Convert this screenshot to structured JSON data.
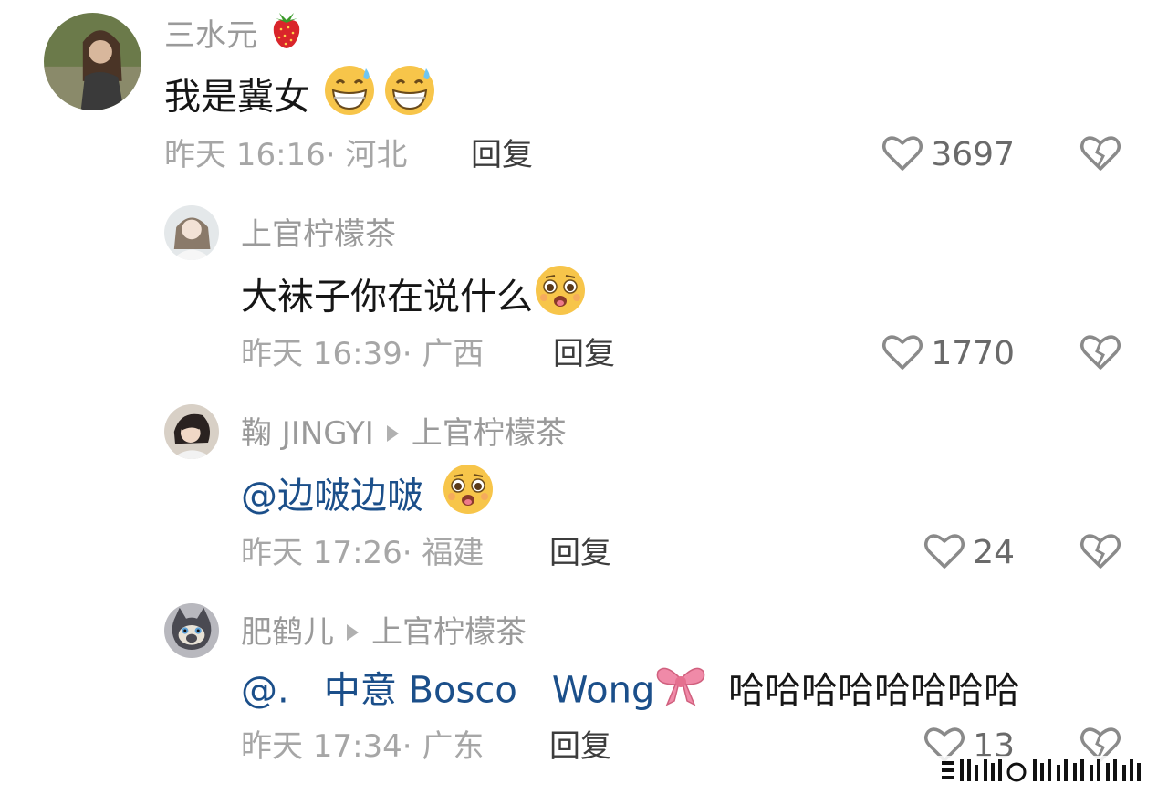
{
  "comments": [
    {
      "username": "三水元",
      "username_emoji": "strawberry-icon",
      "text": "我是冀女",
      "text_emojis": [
        "grinning-sweat-emoji",
        "grinning-sweat-emoji"
      ],
      "meta": "昨天 16:16· 河北",
      "reply_label": "回复",
      "likes": "3697"
    },
    {
      "username": "上官柠檬茶",
      "text": "大袜子你在说什么",
      "text_emojis": [
        "pleading-drool-emoji"
      ],
      "meta": "昨天 16:39· 广西",
      "reply_label": "回复",
      "likes": "1770"
    },
    {
      "username": "鞠 JINGYI",
      "reply_to": "上官柠檬茶",
      "mention": "@边啵边啵",
      "text_emojis": [
        "pleading-drool-emoji"
      ],
      "meta": "昨天 17:26· 福建",
      "reply_label": "回复",
      "likes": "24"
    },
    {
      "username": "肥鹤儿",
      "reply_to": "上官柠檬茶",
      "mention": "@.   中意 Bosco   Wong",
      "mention_emoji": "pink-bow-icon",
      "text": "哈哈哈哈哈哈哈哈",
      "meta": "昨天 17:34· 广东",
      "reply_label": "回复",
      "likes": "13"
    }
  ],
  "colors": {
    "username": "#9a9a9a",
    "meta": "#a6a6a6",
    "mention": "#1b4f8a",
    "text": "#161616"
  }
}
